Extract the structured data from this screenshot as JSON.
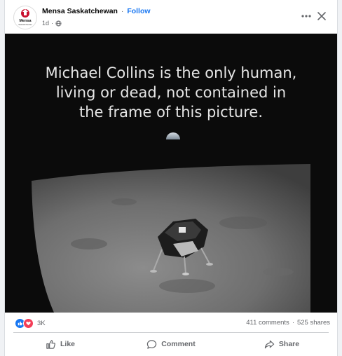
{
  "post": {
    "page_name": "Mensa Saskatchewan",
    "separator": "·",
    "follow_label": "Follow",
    "time": "1d",
    "avatar_text": "Mensa",
    "avatar_subtext": "Saskatchewan",
    "privacy_icon": "globe-icon",
    "more_icon": "more-horizontal-icon",
    "close_icon": "close-icon"
  },
  "image": {
    "caption_lines": [
      "Michael Collins is the only human,",
      "living or dead, not contained in",
      "the frame of this picture."
    ]
  },
  "stats": {
    "reactions": [
      "like",
      "love"
    ],
    "reaction_count": "3K",
    "comments": "411 comments",
    "dot": "·",
    "shares": "525 shares"
  },
  "actions": {
    "like_label": "Like",
    "comment_label": "Comment",
    "share_label": "Share"
  },
  "colors": {
    "brand_blue": "#1877f2",
    "love_red": "#f33e58",
    "secondary_text": "#65676b"
  }
}
